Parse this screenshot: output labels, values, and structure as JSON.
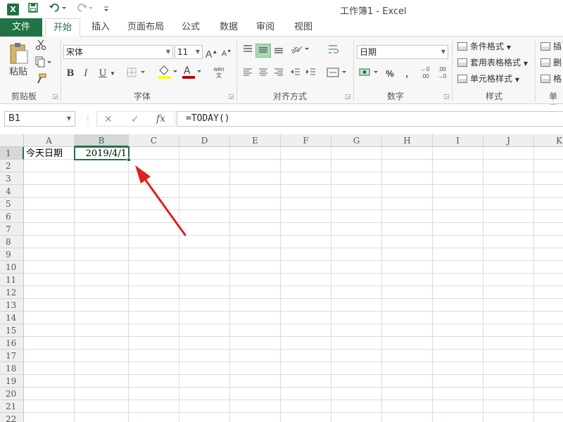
{
  "titlebar": {
    "logo_letter": "X",
    "title": "工作簿1 - Excel",
    "save_icon": "save-icon",
    "undo_icon": "undo-icon",
    "redo_icon": "redo-icon",
    "customize_icon": "customize-qat-icon"
  },
  "tabs": {
    "file": "文件",
    "items": [
      "开始",
      "插入",
      "页面布局",
      "公式",
      "数据",
      "审阅",
      "视图"
    ],
    "active": "开始"
  },
  "ribbon": {
    "clipboard": {
      "paste_label": "粘贴",
      "group_label": "剪贴板"
    },
    "font": {
      "name": "宋体",
      "size": "11",
      "bold": "B",
      "italic": "I",
      "underline": "U",
      "grow": "A",
      "shrink": "A",
      "wen_top": "wén",
      "wen_bottom": "文",
      "group_label": "字体",
      "fill_color": "#ffff00",
      "font_color": "#c00000"
    },
    "alignment": {
      "group_label": "对齐方式"
    },
    "number": {
      "format": "日期",
      "percent": "%",
      "comma": ",",
      "inc": "←0 .00",
      "dec": ".00 →0",
      "group_label": "数字"
    },
    "styles": {
      "conditional": "条件格式",
      "table": "套用表格格式",
      "cell": "单元格样式",
      "group_label": "样式"
    },
    "cells": {
      "insert": "插",
      "delete": "删",
      "format": "格",
      "group_label": "单元"
    }
  },
  "formula_bar": {
    "name_box": "B1",
    "cancel": "✕",
    "enter": "✓",
    "fx": "fx",
    "formula": "=TODAY()"
  },
  "sheet": {
    "columns": [
      "A",
      "B",
      "C",
      "D",
      "E",
      "F",
      "G",
      "H",
      "I",
      "J",
      "K"
    ],
    "rows": [
      "1",
      "2",
      "3",
      "4",
      "5",
      "6",
      "7",
      "8",
      "9",
      "10",
      "11",
      "12",
      "13",
      "14",
      "15",
      "16",
      "17",
      "18",
      "19",
      "20",
      "21",
      "22"
    ],
    "selected_column": "B",
    "selected_row": "1",
    "cells": {
      "A1": "今天日期",
      "B1": "2019/4/1"
    },
    "accent": "#217346",
    "annotation_color": "#e02020"
  }
}
